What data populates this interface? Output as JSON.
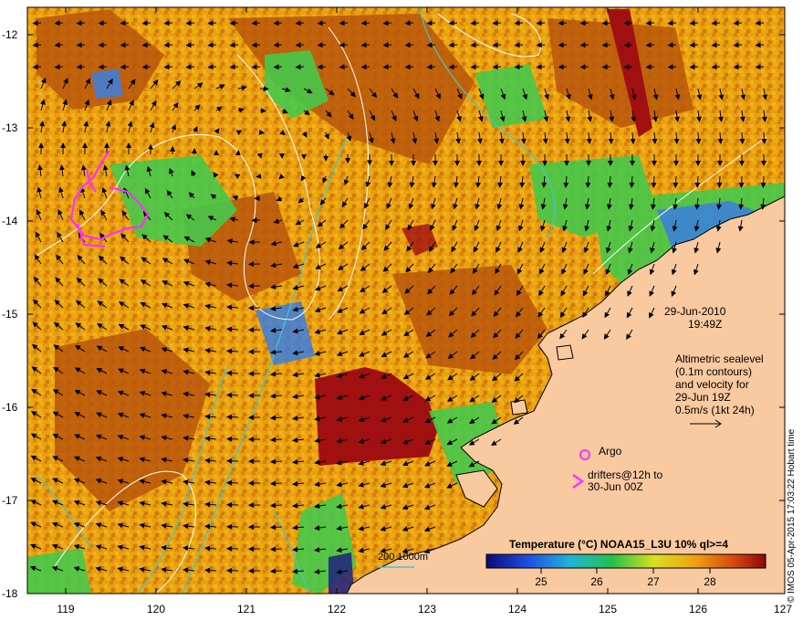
{
  "axes": {
    "y_ticks": [
      "-12",
      "-13",
      "-14",
      "-15",
      "-16",
      "-17",
      "-18"
    ],
    "x_ticks": [
      "119",
      "120",
      "121",
      "122",
      "123",
      "124",
      "125",
      "126",
      "127"
    ]
  },
  "annotations": {
    "date": "29-Jun-2010",
    "time": "19:49Z",
    "altimetry_lines": [
      "Altimetric sealevel",
      "(0.1m contours)",
      "and velocity for",
      "29-Jun 19Z",
      "0.5m/s (1kt 24h)"
    ],
    "argo_label": "Argo",
    "drifter_lines": [
      "drifters@12h to",
      "30-Jun 00Z"
    ]
  },
  "colorbar": {
    "title": "Temperature (°C) NOAA15_L3U 10% ql>=4",
    "ticks": [
      "25",
      "26",
      "27",
      "28"
    ]
  },
  "scale_label": "200  1000m",
  "credit": "© IMOS 05-Apr-2015 17:03:22 Hobart time",
  "colors": {
    "land": "#f9c9a0",
    "sst_warm": "#e89a10",
    "sst_hot": "#a01010",
    "sst_cool": "#46c84a",
    "bathymetry": "#40c8c8",
    "contour": "#ffffff",
    "drifter": "#ff30ff"
  },
  "icons": [
    "argo-circle-icon",
    "drifter-chevron-icon",
    "velocity-arrow-icon"
  ]
}
